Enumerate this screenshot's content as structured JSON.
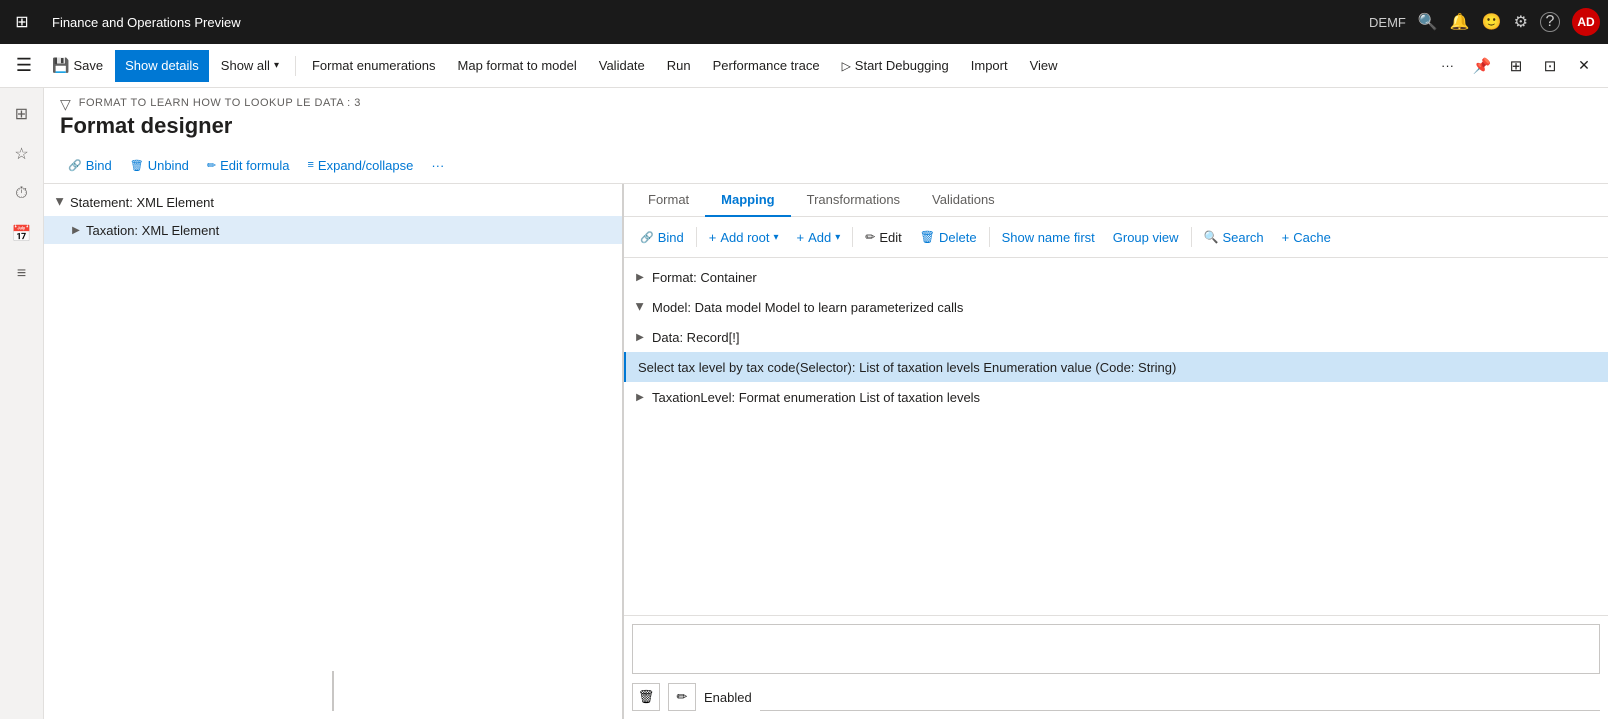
{
  "app": {
    "title": "Finance and Operations Preview",
    "user": "DEMF",
    "avatar": "AD"
  },
  "topbar": {
    "grid_icon": "⊞",
    "search_icon": "🔍",
    "bell_icon": "🔔",
    "face_icon": "🙂",
    "gear_icon": "⚙",
    "help_icon": "?",
    "demf_label": "DEMF"
  },
  "actionbar": {
    "hamburger": "☰",
    "save_label": "Save",
    "show_details_label": "Show details",
    "show_all_label": "Show all",
    "format_enumerations_label": "Format enumerations",
    "map_format_label": "Map format to model",
    "validate_label": "Validate",
    "run_label": "Run",
    "perf_trace_label": "Performance trace",
    "start_debug_label": "Start Debugging",
    "import_label": "Import",
    "view_label": "View",
    "dots_label": "···",
    "pin_icon": "📌",
    "expand_icon": "⊞",
    "more_icon": "⊡",
    "close_icon": "✕"
  },
  "leftnav": {
    "items": [
      {
        "icon": "⊞",
        "name": "home-icon"
      },
      {
        "icon": "☆",
        "name": "favorites-icon"
      },
      {
        "icon": "⏱",
        "name": "recent-icon"
      },
      {
        "icon": "📅",
        "name": "workspaces-icon"
      },
      {
        "icon": "≡",
        "name": "modules-icon"
      }
    ]
  },
  "page": {
    "breadcrumb": "FORMAT TO LEARN HOW TO LOOKUP LE DATA : 3",
    "title": "Format designer",
    "filter_icon": "▽"
  },
  "page_toolbar": {
    "bind_label": "Bind",
    "unbind_label": "Unbind",
    "edit_formula_label": "Edit formula",
    "expand_collapse_label": "Expand/collapse",
    "more_label": "···"
  },
  "left_tree": {
    "items": [
      {
        "label": "Statement: XML Element",
        "level": 0,
        "expanded": true,
        "chevron_state": "expanded",
        "selected": false
      },
      {
        "label": "Taxation: XML Element",
        "level": 1,
        "expanded": false,
        "chevron_state": "collapsed",
        "selected": true
      }
    ]
  },
  "tabs": [
    {
      "label": "Format",
      "active": false
    },
    {
      "label": "Mapping",
      "active": true
    },
    {
      "label": "Transformations",
      "active": false
    },
    {
      "label": "Validations",
      "active": false
    }
  ],
  "right_toolbar": {
    "bind_label": "Bind",
    "add_root_label": "Add root",
    "add_label": "Add",
    "edit_label": "Edit",
    "delete_label": "Delete",
    "show_name_first_label": "Show name first",
    "group_view_label": "Group view",
    "search_label": "Search",
    "cache_label": "Cache",
    "chevron_icon": "▾"
  },
  "right_tree": {
    "items": [
      {
        "label": "Format: Container",
        "level": 0,
        "expanded": false,
        "chevron_state": "collapsed",
        "selected": false
      },
      {
        "label": "Model: Data model Model to learn parameterized calls",
        "level": 0,
        "expanded": true,
        "chevron_state": "expanded",
        "selected": false
      },
      {
        "label": "Data: Record[!]",
        "level": 1,
        "expanded": false,
        "chevron_state": "collapsed",
        "selected": false
      },
      {
        "label": "Select tax level by tax code(Selector): List of taxation levels Enumeration value (Code: String)",
        "level": 2,
        "expanded": false,
        "chevron_state": null,
        "selected": true
      },
      {
        "label": "TaxationLevel: Format enumeration List of taxation levels",
        "level": 1,
        "expanded": false,
        "chevron_state": "collapsed",
        "selected": false
      }
    ]
  },
  "bottom": {
    "delete_icon": "🗑",
    "edit_icon": "✏",
    "enabled_label": "Enabled"
  }
}
